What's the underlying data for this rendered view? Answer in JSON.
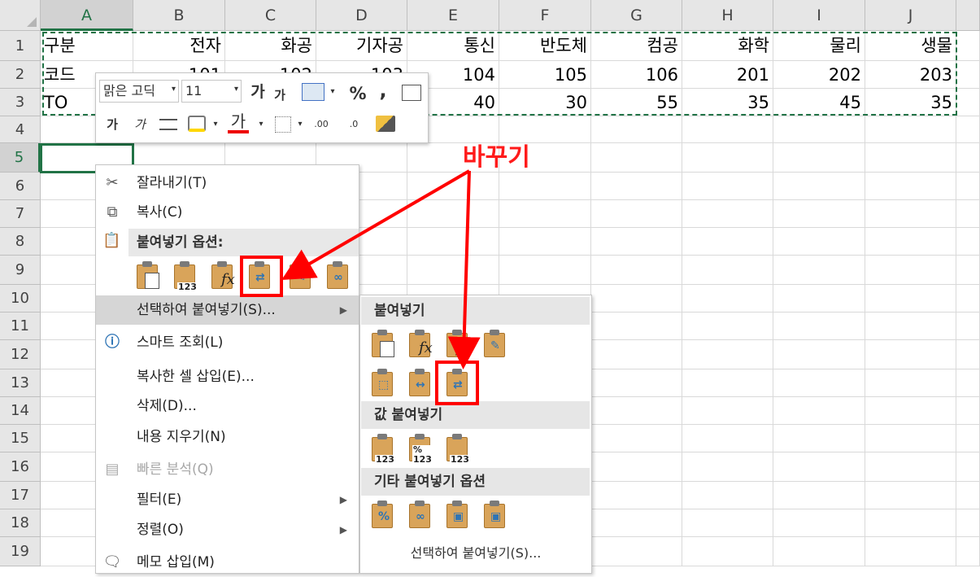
{
  "columns": [
    "A",
    "B",
    "C",
    "D",
    "E",
    "F",
    "G",
    "H",
    "I",
    "J"
  ],
  "rows": [
    "1",
    "2",
    "3",
    "4",
    "5",
    "6",
    "7",
    "8",
    "9",
    "10",
    "11",
    "12",
    "13",
    "14",
    "15",
    "16",
    "17",
    "18",
    "19"
  ],
  "sheet": {
    "row1": [
      "구분",
      "전자",
      "화공",
      "기자공",
      "통신",
      "반도체",
      "컴공",
      "화학",
      "물리",
      "생물"
    ],
    "row2": [
      "코드",
      "101",
      "102",
      "103",
      "104",
      "105",
      "106",
      "201",
      "202",
      "203"
    ],
    "row3": [
      "TO",
      "",
      "",
      "",
      "40",
      "30",
      "55",
      "35",
      "45",
      "35"
    ]
  },
  "mini_toolbar": {
    "font_name": "맑은 고딕",
    "font_size": "11",
    "grow": "가",
    "shrink": "가",
    "percent": "%",
    "comma": ",",
    "bold": "가",
    "italic": "가",
    "font_color": "가",
    "inc_decimal": ".00",
    "dec_decimal": ".0"
  },
  "context_menu": {
    "items": [
      {
        "label": "잘라내기(T)",
        "icon": "scissors-icon"
      },
      {
        "label": "복사(C)",
        "icon": "copy-icon"
      },
      {
        "label": "붙여넣기 옵션:",
        "icon": "paste-icon"
      },
      {
        "label": "선택하여 붙여넣기(S)...",
        "icon": ""
      },
      {
        "label": "스마트 조회(L)",
        "icon": "smart-lookup-icon"
      },
      {
        "label": "복사한 셀 삽입(E)...",
        "icon": ""
      },
      {
        "label": "삭제(D)...",
        "icon": ""
      },
      {
        "label": "내용 지우기(N)",
        "icon": ""
      },
      {
        "label": "빠른 분석(Q)",
        "icon": "quick-analysis-icon"
      },
      {
        "label": "필터(E)",
        "icon": ""
      },
      {
        "label": "정렬(O)",
        "icon": ""
      },
      {
        "label": "메모 삽입(M)",
        "icon": "comment-icon"
      }
    ],
    "paste_icons": [
      "paste-icon",
      "paste-values-icon",
      "paste-formulas-icon",
      "paste-transpose-icon",
      "paste-formatting-icon",
      "paste-link-icon"
    ],
    "paste_sub_labels": [
      "",
      "123",
      "fx",
      "",
      "",
      ""
    ]
  },
  "submenu": {
    "section_paste": "붙여넣기",
    "section_values": "값 붙여넣기",
    "section_other": "기타 붙여넣기 옵션",
    "footer": "선택하여 붙여넣기(S)...",
    "values_labels": [
      "123",
      "%\n123",
      "123"
    ]
  },
  "annotation": {
    "text": "바꾸기",
    "color": "#ff0000"
  },
  "colors": {
    "accent": "#217346",
    "highlight_red": "#ff0000"
  }
}
